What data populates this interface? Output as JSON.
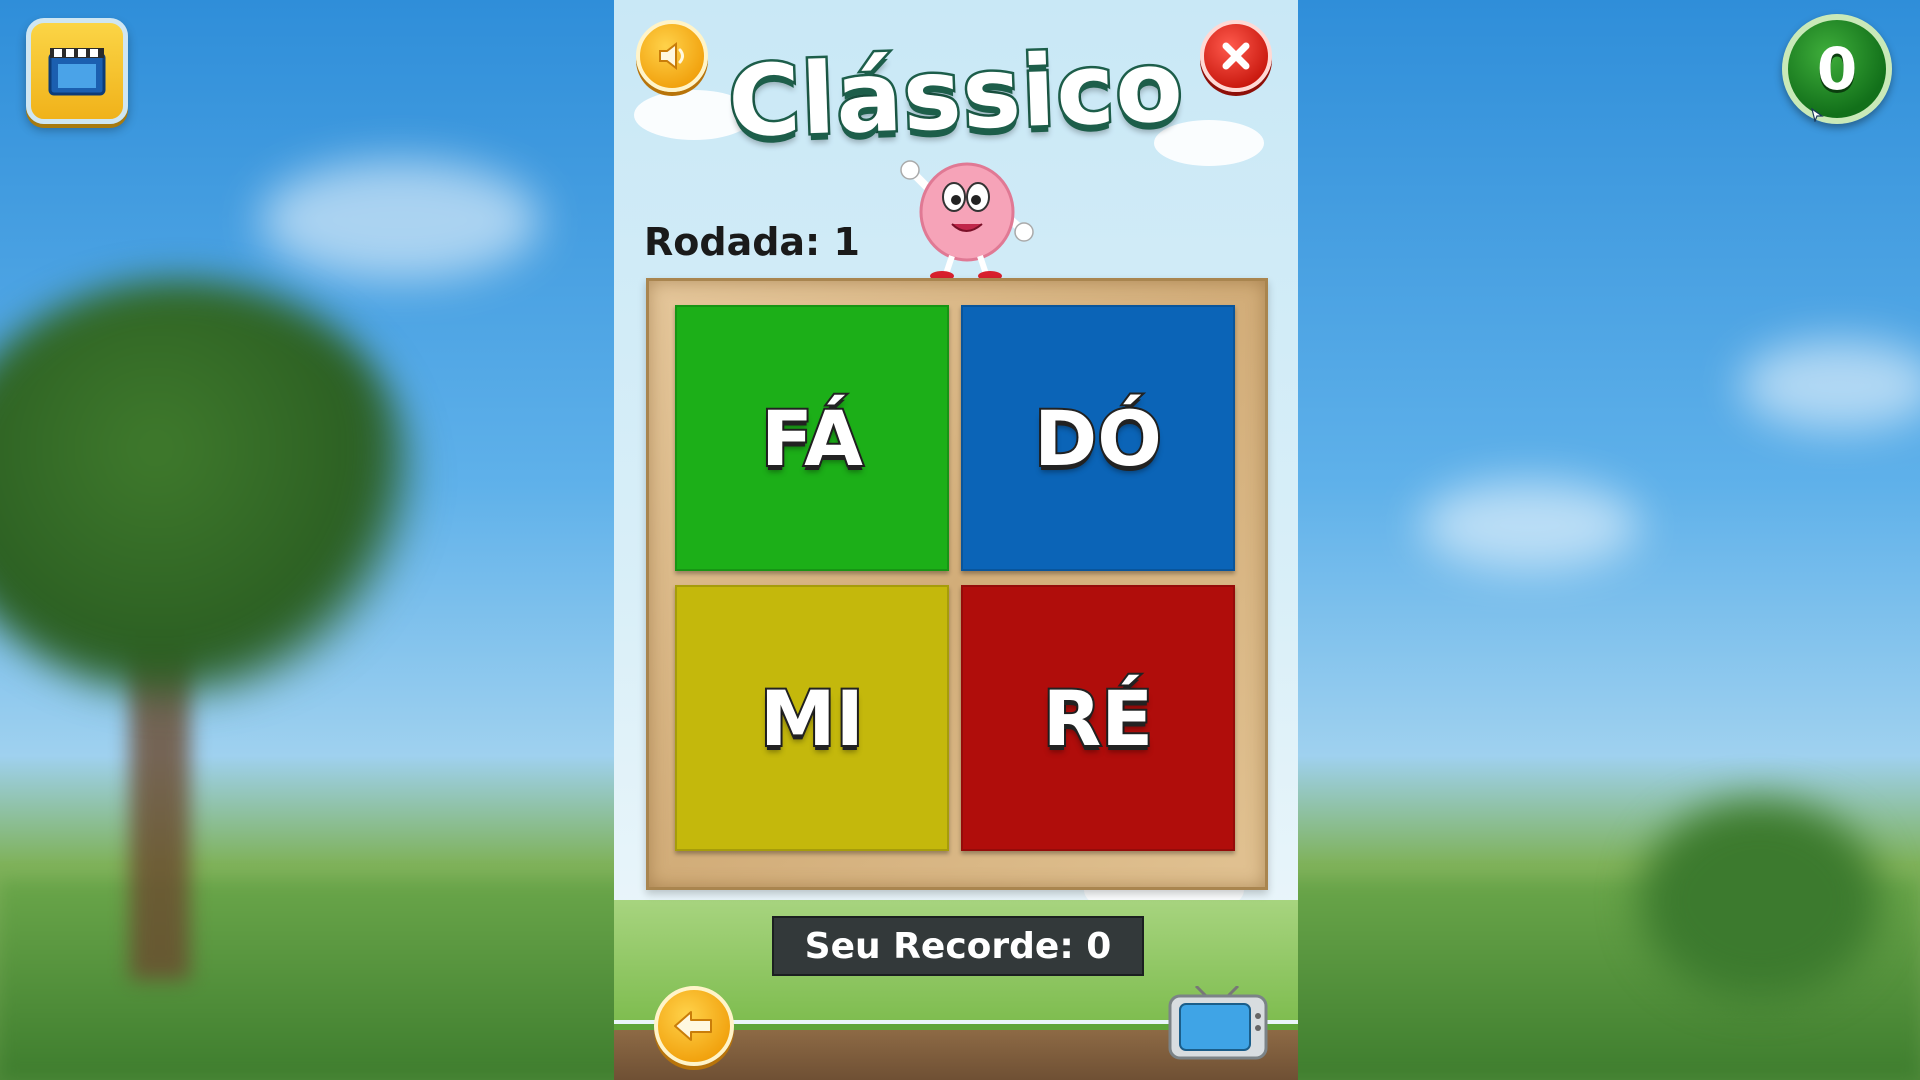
{
  "game": {
    "title": "Clássico",
    "round_label": "Rodada: 1",
    "record_label": "Seu Recorde: 0",
    "score": "0"
  },
  "tiles": [
    {
      "label": "FÁ",
      "color": "#1caf18"
    },
    {
      "label": "DÓ",
      "color": "#0b64b7"
    },
    {
      "label": "MI",
      "color": "#c4b80c"
    },
    {
      "label": "RÉ",
      "color": "#b00d0b"
    }
  ],
  "icons": {
    "top_left": "video-reward-icon",
    "sound": "speaker-icon",
    "close": "close-icon",
    "back": "back-arrow-icon",
    "tv": "tv-icon",
    "mascot": "pink-mascot"
  }
}
